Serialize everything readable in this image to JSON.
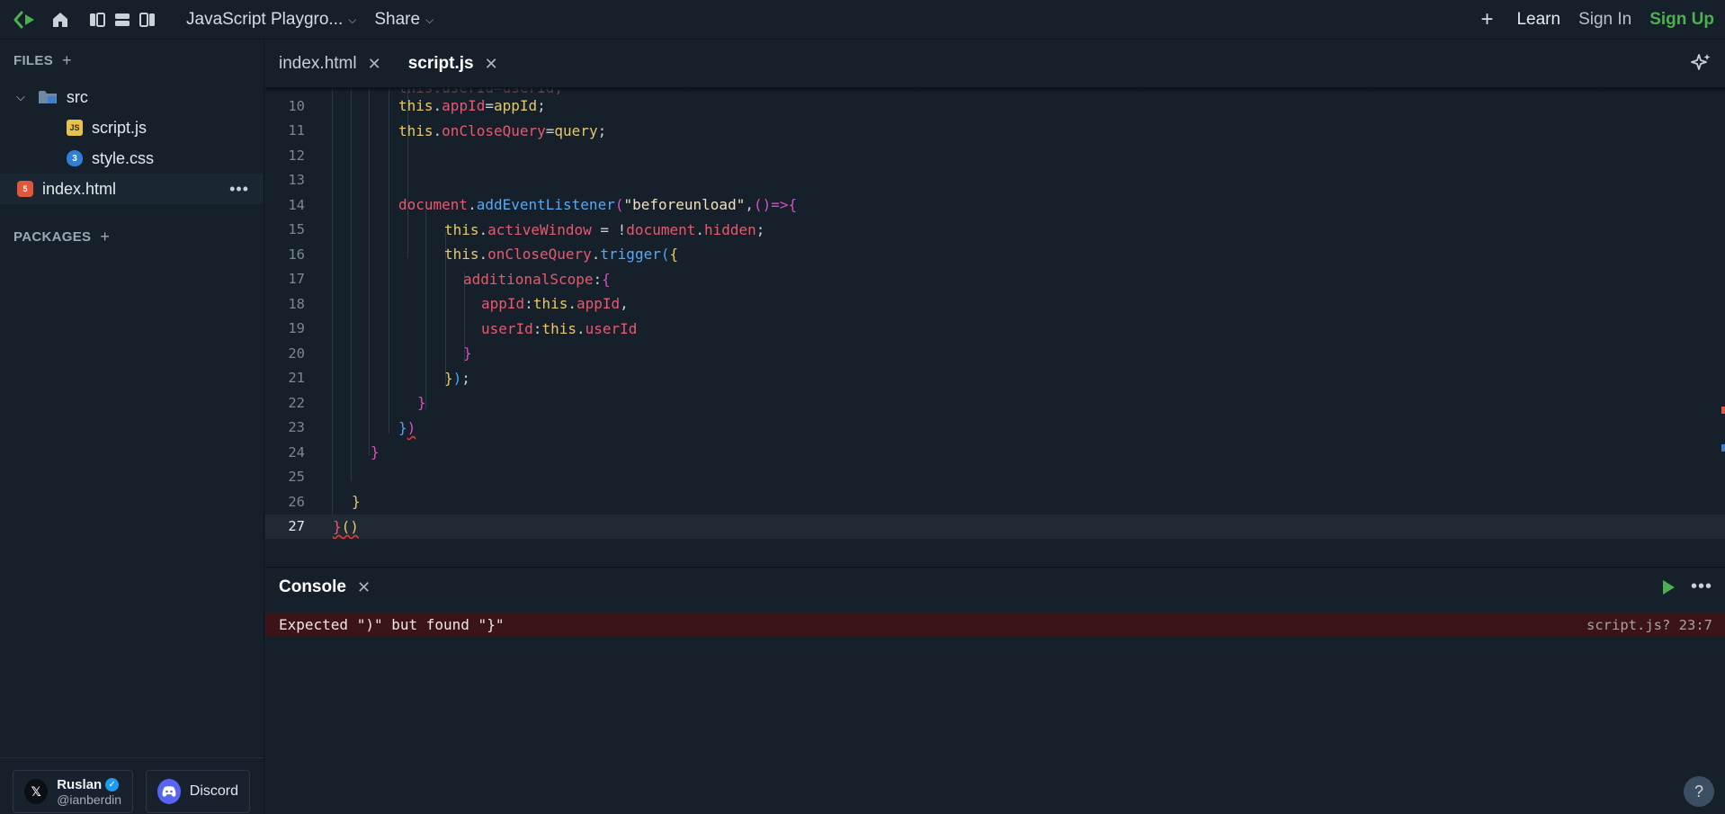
{
  "topbar": {
    "project_title": "JavaScript Playgro...",
    "share_label": "Share",
    "learn_label": "Learn",
    "signin_label": "Sign In",
    "signup_label": "Sign Up",
    "plus_label": "+"
  },
  "sidebar": {
    "files_label": "FILES",
    "packages_label": "PACKAGES",
    "tree": [
      {
        "label": "src",
        "type": "folder",
        "expanded": true
      },
      {
        "label": "script.js",
        "type": "js"
      },
      {
        "label": "style.css",
        "type": "css"
      },
      {
        "label": "index.html",
        "type": "html",
        "active": true
      }
    ],
    "author": {
      "name": "Ruslan",
      "handle": "@ianberdin",
      "icon": "x-logo-icon"
    },
    "discord_label": "Discord"
  },
  "editor": {
    "tabs": [
      {
        "label": "index.html",
        "active": false
      },
      {
        "label": "script.js",
        "active": true
      }
    ],
    "line_numbers": [
      "10",
      "11",
      "12",
      "13",
      "14",
      "15",
      "16",
      "17",
      "18",
      "19",
      "20",
      "21",
      "22",
      "23",
      "24",
      "25",
      "26",
      "27"
    ],
    "code": {
      "l9": "this.userId=userId;",
      "l10": [
        "this",
        ".",
        "appId",
        "=",
        "appId",
        ";"
      ],
      "l11": [
        "this",
        ".",
        "onCloseQuery",
        "=",
        "query",
        ";"
      ],
      "l14": [
        "document",
        ".",
        "addEventListener",
        "(",
        "\"beforeunload\"",
        ",",
        "()",
        "=>",
        "{"
      ],
      "l15": [
        "this",
        ".",
        "activeWindow",
        " = !",
        "document",
        ".",
        "hidden",
        ";"
      ],
      "l16": [
        "this",
        ".",
        "onCloseQuery",
        ".",
        "trigger",
        "(",
        "{"
      ],
      "l17": [
        "additionalScope",
        ":",
        "{"
      ],
      "l18": [
        "appId",
        ":",
        "this",
        ".",
        "appId",
        ","
      ],
      "l19": [
        "userId",
        ":",
        "this",
        ".",
        "userId"
      ],
      "l20": "}",
      "l21": [
        "}",
        ")",
        ";"
      ],
      "l22": "}",
      "l23": [
        "}",
        ")"
      ],
      "l24": "}",
      "l26": "}",
      "l27": [
        "}",
        "()"
      ]
    }
  },
  "console": {
    "title": "Console",
    "error_message": "Expected \")\" but found \"}\"",
    "error_location": "script.js? 23:7",
    "help_label": "?"
  },
  "colors": {
    "background": "#15202b",
    "accent_green": "#4caf50",
    "error_row": "#3a1416"
  }
}
